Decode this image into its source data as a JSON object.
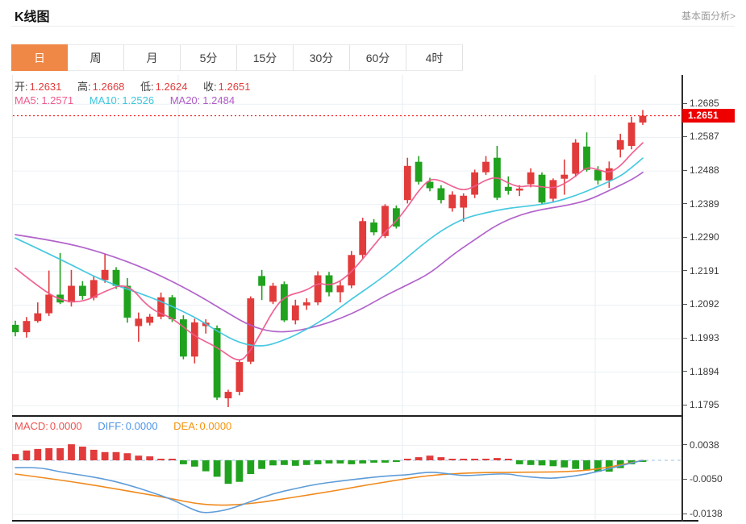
{
  "header": {
    "title": "K线图",
    "analysis_link": "基本面分析>"
  },
  "toolbar": {
    "tabs": [
      "日",
      "周",
      "月",
      "5分",
      "15分",
      "30分",
      "60分",
      "4时"
    ],
    "active_tab": "日"
  },
  "quote_bar": {
    "open_label": "开:",
    "open": "1.2631",
    "high_label": "高:",
    "high": "1.2668",
    "low_label": "低:",
    "low": "1.2624",
    "close_label": "收:",
    "close": "1.2651"
  },
  "ma_bar": {
    "ma5_label": "MA5:",
    "ma5": "1.2571",
    "ma10_label": "MA10:",
    "ma10": "1.2526",
    "ma20_label": "MA20:",
    "ma20": "1.2484"
  },
  "macd_bar": {
    "macd_label": "MACD:",
    "macd": "0.0000",
    "diff_label": "DIFF:",
    "diff": "0.0000",
    "dea_label": "DEA:",
    "dea": "0.0000"
  },
  "price_axis": {
    "ticks": [
      "1.2685",
      "1.2587",
      "1.2488",
      "1.2389",
      "1.2290",
      "1.2191",
      "1.2092",
      "1.1993",
      "1.1894",
      "1.1795"
    ],
    "last_price": "1.2651"
  },
  "macd_axis": {
    "ticks": [
      "0.0038",
      "-0.0050",
      "-0.0138"
    ]
  },
  "colors": {
    "up": "#E23B3B",
    "down": "#21A21F",
    "ma5": "#EE5C8D",
    "ma10": "#3EC6DE",
    "ma20": "#AE5BC8",
    "diff": "#5E9CD8",
    "dea": "#F08A1E",
    "badge": "#EE0000",
    "price_line": "#F20000",
    "accent_tab": "#EF8747",
    "grid": "#ECF1F5",
    "vgrid": "#E7EDF3",
    "zero_dash": "#BCD6EE"
  },
  "chart_data": {
    "type": "candlestick+macd",
    "title": "K线图",
    "period": "日",
    "legend": [
      "MA5",
      "MA10",
      "MA20",
      "MACD",
      "DIFF",
      "DEA"
    ],
    "grid": true,
    "last_price": 1.2651,
    "y_axis_ticks": [
      1.2685,
      1.2587,
      1.2488,
      1.2389,
      1.229,
      1.2191,
      1.2092,
      1.1993,
      1.1894,
      1.1795
    ],
    "macd_ticks": [
      0.0038,
      -0.005,
      -0.0138
    ],
    "candles": [
      [
        1.2034,
        1.2046,
        1.2,
        1.2012
      ],
      [
        1.2012,
        1.2057,
        1.1996,
        1.2045
      ],
      [
        1.2045,
        1.21,
        1.204,
        1.2068
      ],
      [
        1.2068,
        1.2194,
        1.206,
        1.2123
      ],
      [
        1.2123,
        1.2246,
        1.2095,
        1.21
      ],
      [
        1.21,
        1.2196,
        1.2088,
        1.2149
      ],
      [
        1.2149,
        1.2163,
        1.2108,
        1.2119
      ],
      [
        1.2114,
        1.2178,
        1.2106,
        1.2166
      ],
      [
        1.2166,
        1.2244,
        1.2158,
        1.2196
      ],
      [
        1.2196,
        1.2204,
        1.214,
        1.2149
      ],
      [
        1.2149,
        1.2172,
        1.204,
        1.2055
      ],
      [
        1.203,
        1.207,
        1.1984,
        1.2052
      ],
      [
        1.204,
        1.2066,
        1.2032,
        1.2058
      ],
      [
        1.2058,
        1.2129,
        1.205,
        1.2115
      ],
      [
        1.2115,
        1.2122,
        1.2042,
        1.205
      ],
      [
        1.205,
        1.2062,
        1.1932,
        1.194
      ],
      [
        1.194,
        1.2052,
        1.192,
        1.2041
      ],
      [
        1.203,
        1.205,
        1.2008,
        1.204
      ],
      [
        1.2024,
        1.2032,
        1.1812,
        1.1819
      ],
      [
        1.1817,
        1.1842,
        1.1791,
        1.1836
      ],
      [
        1.1836,
        1.1932,
        1.1826,
        1.1924
      ],
      [
        1.1925,
        1.2118,
        1.1918,
        1.2112
      ],
      [
        1.2178,
        1.2196,
        1.2107,
        1.2149
      ],
      [
        1.2102,
        1.2158,
        1.2095,
        1.2149
      ],
      [
        1.2154,
        1.2162,
        1.2042,
        1.2047
      ],
      [
        1.2047,
        1.2108,
        1.2035,
        1.2091
      ],
      [
        1.2091,
        1.2112,
        1.2078,
        1.21
      ],
      [
        1.21,
        1.2192,
        1.2092,
        1.218
      ],
      [
        1.218,
        1.219,
        1.2118,
        1.213
      ],
      [
        1.213,
        1.2162,
        1.21,
        1.215
      ],
      [
        1.215,
        1.2252,
        1.2142,
        1.224
      ],
      [
        1.224,
        1.235,
        1.223,
        1.234
      ],
      [
        1.2336,
        1.2346,
        1.2298,
        1.2307
      ],
      [
        1.2296,
        1.239,
        1.229,
        1.2385
      ],
      [
        1.2378,
        1.2386,
        1.2318,
        1.2324
      ],
      [
        1.2402,
        1.2527,
        1.2392,
        1.2503
      ],
      [
        1.2515,
        1.2532,
        1.2448,
        1.2456
      ],
      [
        1.2456,
        1.2468,
        1.2428,
        1.2437
      ],
      [
        1.2437,
        1.2446,
        1.2392,
        1.2402
      ],
      [
        1.2378,
        1.2428,
        1.2368,
        1.2418
      ],
      [
        1.238,
        1.2422,
        1.2338,
        1.2415
      ],
      [
        1.2418,
        1.2492,
        1.2408,
        1.2484
      ],
      [
        1.2484,
        1.2532,
        1.2476,
        1.2515
      ],
      [
        1.2527,
        1.2562,
        1.2402,
        1.2409
      ],
      [
        1.2441,
        1.2472,
        1.2418,
        1.2429
      ],
      [
        1.243,
        1.2446,
        1.2414,
        1.2436
      ],
      [
        1.2449,
        1.2496,
        1.244,
        1.2484
      ],
      [
        1.2477,
        1.2484,
        1.2388,
        1.2395
      ],
      [
        1.2406,
        1.2466,
        1.2396,
        1.2461
      ],
      [
        1.2465,
        1.2522,
        1.2418,
        1.2477
      ],
      [
        1.248,
        1.2582,
        1.247,
        1.2572
      ],
      [
        1.256,
        1.2602,
        1.2486,
        1.2491
      ],
      [
        1.2491,
        1.2502,
        1.2448,
        1.246
      ],
      [
        1.246,
        1.2516,
        1.2438,
        1.2496
      ],
      [
        1.2551,
        1.2598,
        1.2528,
        1.2579
      ],
      [
        1.2562,
        1.2648,
        1.2552,
        1.2631
      ],
      [
        1.2631,
        1.2668,
        1.2624,
        1.2651
      ]
    ],
    "ma5_points": [
      [
        0,
        1.2201
      ],
      [
        2,
        1.2148
      ],
      [
        4,
        1.2105
      ],
      [
        6,
        1.21
      ],
      [
        8,
        1.2133
      ],
      [
        10,
        1.2158
      ],
      [
        12,
        1.208
      ],
      [
        14,
        1.2055
      ],
      [
        16,
        1.2
      ],
      [
        18,
        1.1968
      ],
      [
        20,
        1.192
      ],
      [
        21,
        1.1958
      ],
      [
        22,
        1.2015
      ],
      [
        23,
        1.2075
      ],
      [
        24,
        1.2118
      ],
      [
        26,
        1.2135
      ],
      [
        27,
        1.2158
      ],
      [
        28,
        1.215
      ],
      [
        29,
        1.2162
      ],
      [
        30,
        1.219
      ],
      [
        31,
        1.2228
      ],
      [
        32,
        1.2268
      ],
      [
        33,
        1.2308
      ],
      [
        34,
        1.234
      ],
      [
        35,
        1.2382
      ],
      [
        36,
        1.243
      ],
      [
        37,
        1.2465
      ],
      [
        38,
        1.246
      ],
      [
        39,
        1.2442
      ],
      [
        40,
        1.243
      ],
      [
        41,
        1.2442
      ],
      [
        42,
        1.2462
      ],
      [
        43,
        1.247
      ],
      [
        44,
        1.2452
      ],
      [
        45,
        1.244
      ],
      [
        46,
        1.2446
      ],
      [
        48,
        1.2436
      ],
      [
        49,
        1.245
      ],
      [
        50,
        1.2472
      ],
      [
        51,
        1.25
      ],
      [
        52,
        1.2492
      ],
      [
        53,
        1.2482
      ],
      [
        54,
        1.2502
      ],
      [
        55,
        1.254
      ],
      [
        56,
        1.2571
      ]
    ],
    "ma10_points": [
      [
        0,
        1.229
      ],
      [
        4,
        1.2228
      ],
      [
        8,
        1.216
      ],
      [
        12,
        1.2118
      ],
      [
        16,
        1.2058
      ],
      [
        18,
        1.2015
      ],
      [
        20,
        1.198
      ],
      [
        22,
        1.1968
      ],
      [
        24,
        1.1988
      ],
      [
        26,
        1.202
      ],
      [
        28,
        1.206
      ],
      [
        30,
        1.211
      ],
      [
        32,
        1.2155
      ],
      [
        34,
        1.2205
      ],
      [
        36,
        1.2262
      ],
      [
        38,
        1.2312
      ],
      [
        40,
        1.2348
      ],
      [
        42,
        1.2365
      ],
      [
        44,
        1.2378
      ],
      [
        46,
        1.2385
      ],
      [
        48,
        1.2395
      ],
      [
        50,
        1.2415
      ],
      [
        52,
        1.2442
      ],
      [
        54,
        1.2472
      ],
      [
        55,
        1.2498
      ],
      [
        56,
        1.2526
      ]
    ],
    "ma20_points": [
      [
        0,
        1.23
      ],
      [
        4,
        1.228
      ],
      [
        8,
        1.2245
      ],
      [
        12,
        1.2195
      ],
      [
        16,
        1.2128
      ],
      [
        19,
        1.2068
      ],
      [
        21,
        1.203
      ],
      [
        23,
        1.2012
      ],
      [
        25,
        1.2015
      ],
      [
        27,
        1.203
      ],
      [
        29,
        1.2052
      ],
      [
        31,
        1.2082
      ],
      [
        33,
        1.212
      ],
      [
        35,
        1.2152
      ],
      [
        37,
        1.2185
      ],
      [
        39,
        1.224
      ],
      [
        41,
        1.2285
      ],
      [
        43,
        1.233
      ],
      [
        45,
        1.2358
      ],
      [
        47,
        1.2375
      ],
      [
        49,
        1.2385
      ],
      [
        51,
        1.24
      ],
      [
        53,
        1.243
      ],
      [
        55,
        1.2462
      ],
      [
        56,
        1.2484
      ]
    ],
    "macd": {
      "last": {
        "macd": 0.0,
        "diff": 0.0,
        "dea": 0.0
      },
      "histogram": [
        0.0016,
        0.0025,
        0.0029,
        0.0031,
        0.0031,
        0.0041,
        0.0035,
        0.0027,
        0.0021,
        0.0021,
        0.0018,
        0.0012,
        0.001,
        0.0004,
        0.0002,
        -0.001,
        -0.0016,
        -0.0028,
        -0.0042,
        -0.006,
        -0.0055,
        -0.0035,
        -0.0022,
        -0.0013,
        -0.0012,
        -0.0014,
        -0.0012,
        -0.001,
        -0.0008,
        -0.0008,
        -0.001,
        -0.0008,
        -0.0006,
        -0.0006,
        -0.0004,
        0.0002,
        0.0008,
        0.0012,
        0.0008,
        0.0004,
        0.0002,
        0.0001,
        0.0004,
        0.0006,
        0.0002,
        -0.001,
        -0.0012,
        -0.0013,
        -0.0015,
        -0.0018,
        -0.0022,
        -0.0026,
        -0.0029,
        -0.0029,
        -0.002,
        -0.001,
        -0.0002
      ],
      "diff_points": [
        [
          0,
          -0.0019
        ],
        [
          2,
          -0.0017
        ],
        [
          4,
          -0.003
        ],
        [
          6,
          -0.0038
        ],
        [
          8,
          -0.0048
        ],
        [
          10,
          -0.0062
        ],
        [
          12,
          -0.008
        ],
        [
          14,
          -0.01
        ],
        [
          16,
          -0.0128
        ],
        [
          17,
          -0.0135
        ],
        [
          19,
          -0.0126
        ],
        [
          21,
          -0.0105
        ],
        [
          23,
          -0.0085
        ],
        [
          25,
          -0.0072
        ],
        [
          27,
          -0.006
        ],
        [
          29,
          -0.0053
        ],
        [
          31,
          -0.0046
        ],
        [
          33,
          -0.004
        ],
        [
          35,
          -0.0037
        ],
        [
          36,
          -0.0033
        ],
        [
          37,
          -0.003
        ],
        [
          38,
          -0.0032
        ],
        [
          40,
          -0.004
        ],
        [
          42,
          -0.0036
        ],
        [
          44,
          -0.0034
        ],
        [
          45,
          -0.004
        ],
        [
          47,
          -0.0045
        ],
        [
          48,
          -0.0046
        ],
        [
          50,
          -0.004
        ],
        [
          52,
          -0.0029
        ],
        [
          54,
          -0.0014
        ],
        [
          56,
          0.0
        ]
      ],
      "dea_points": [
        [
          0,
          -0.0035
        ],
        [
          4,
          -0.005
        ],
        [
          8,
          -0.0068
        ],
        [
          12,
          -0.0088
        ],
        [
          14,
          -0.0098
        ],
        [
          16,
          -0.011
        ],
        [
          18,
          -0.0115
        ],
        [
          20,
          -0.0113
        ],
        [
          22,
          -0.0107
        ],
        [
          24,
          -0.0098
        ],
        [
          26,
          -0.0089
        ],
        [
          28,
          -0.008
        ],
        [
          30,
          -0.007
        ],
        [
          32,
          -0.006
        ],
        [
          34,
          -0.0051
        ],
        [
          36,
          -0.0042
        ],
        [
          38,
          -0.0036
        ],
        [
          40,
          -0.0033
        ],
        [
          42,
          -0.0031
        ],
        [
          44,
          -0.0031
        ],
        [
          46,
          -0.003
        ],
        [
          48,
          -0.003
        ],
        [
          50,
          -0.0028
        ],
        [
          52,
          -0.0022
        ],
        [
          54,
          -0.0012
        ],
        [
          56,
          0.0
        ]
      ]
    }
  }
}
